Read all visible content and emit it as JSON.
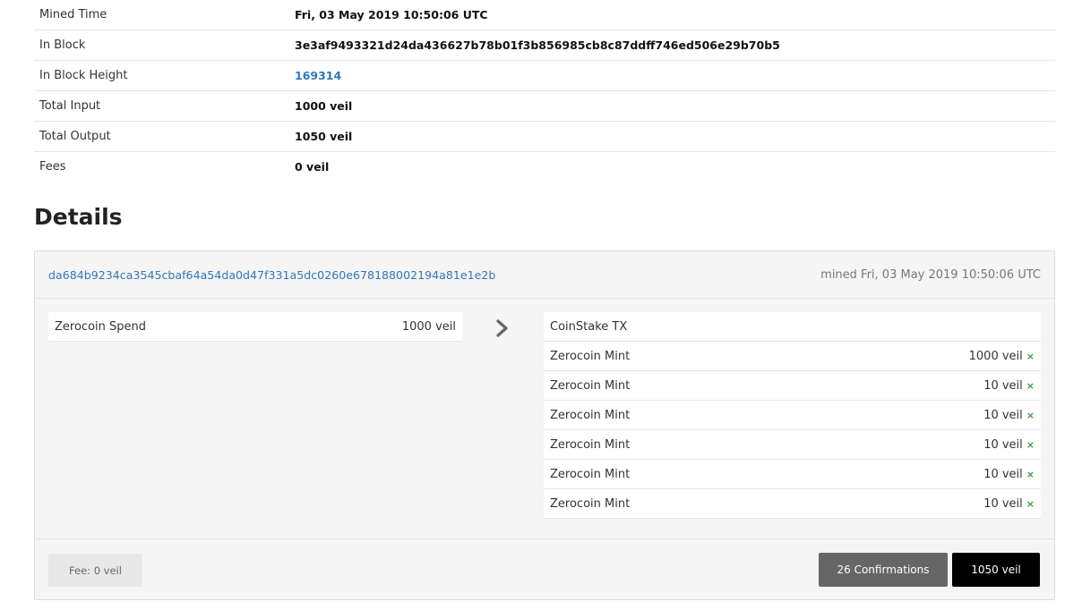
{
  "summary": [
    {
      "label": "Mined Time",
      "value": "Fri, 03 May 2019 10:50:06 UTC"
    },
    {
      "label": "In Block",
      "value": "3e3af9493321d24da436627b78b01f3b856985cb8c87ddff746ed506e29b70b5"
    },
    {
      "label": "In Block Height",
      "value": "169314"
    },
    {
      "label": "Total Input",
      "value": "1000 veil"
    },
    {
      "label": "Total Output",
      "value": "1050 veil"
    },
    {
      "label": "Fees",
      "value": "0 veil"
    }
  ],
  "details": {
    "title": "Details",
    "tx_hash": "da684b9234ca3545cbaf64a54da0d47f331a5dc0260e678188002194a81e1e2b",
    "mined": "mined Fri, 03 May 2019 10:50:06 UTC",
    "inputs": [
      {
        "label": "Zerocoin Spend",
        "amount": "1000 veil"
      }
    ],
    "outputs": [
      {
        "label": "CoinStake TX",
        "amount": ""
      },
      {
        "label": "Zerocoin Mint",
        "amount": "1000 veil",
        "mark": "×"
      },
      {
        "label": "Zerocoin Mint",
        "amount": "10 veil",
        "mark": "×"
      },
      {
        "label": "Zerocoin Mint",
        "amount": "10 veil",
        "mark": "×"
      },
      {
        "label": "Zerocoin Mint",
        "amount": "10 veil",
        "mark": "×"
      },
      {
        "label": "Zerocoin Mint",
        "amount": "10 veil",
        "mark": "×"
      },
      {
        "label": "Zerocoin Mint",
        "amount": "10 veil",
        "mark": "×"
      }
    ],
    "fee": "Fee: 0 veil",
    "confirmations": "26 Confirmations",
    "total": "1050 veil"
  },
  "colors": {
    "link": "#2f78b7",
    "mark": "#3c9a3c",
    "conf_bg": "#666666",
    "total_bg": "#000000"
  },
  "icons": {
    "arrow": "chevron-right-icon"
  }
}
